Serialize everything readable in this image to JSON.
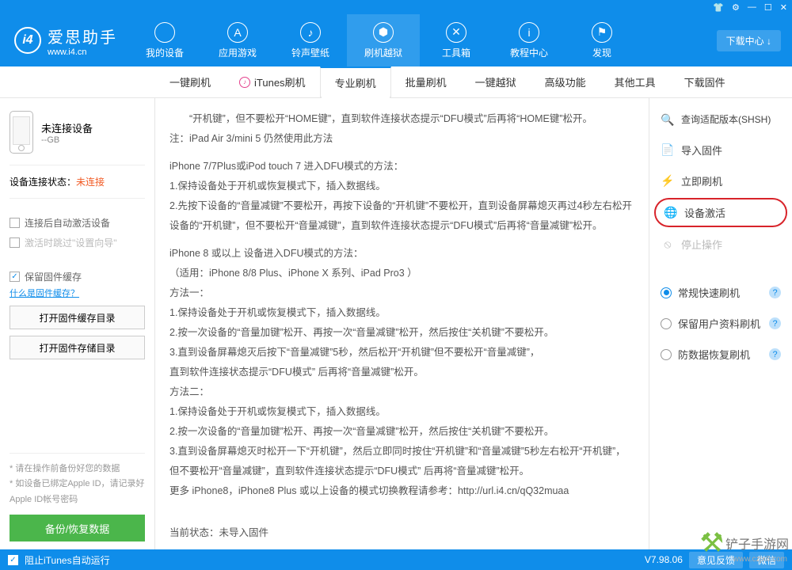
{
  "app": {
    "name": "爱思助手",
    "url": "www.i4.cn"
  },
  "window_ctrl": [
    "👕",
    "⚙",
    "—",
    "☐",
    "✕"
  ],
  "nav": [
    {
      "label": "我的设备",
      "icon": ""
    },
    {
      "label": "应用游戏",
      "icon": "A"
    },
    {
      "label": "铃声壁纸",
      "icon": "♪"
    },
    {
      "label": "刷机越狱",
      "icon": "⬢",
      "active": true
    },
    {
      "label": "工具箱",
      "icon": "✕"
    },
    {
      "label": "教程中心",
      "icon": "i"
    },
    {
      "label": "发现",
      "icon": "⚑"
    }
  ],
  "dl_center": "下载中心 ↓",
  "subnav": [
    "一键刷机",
    "iTunes刷机",
    "专业刷机",
    "批量刷机",
    "一键越狱",
    "高级功能",
    "其他工具",
    "下载固件"
  ],
  "subnav_active": 2,
  "device": {
    "name": "未连接设备",
    "size": "--GB"
  },
  "conn_status_label": "设备连接状态：",
  "conn_status_value": "未连接",
  "options": {
    "auto_activate": "连接后自动激活设备",
    "skip_wizard": "激活时跳过\"设置向导\"",
    "keep_cache": "保留固件缓存",
    "cache_help": "什么是固件缓存？"
  },
  "side_buttons": {
    "open_cache": "打开固件缓存目录",
    "open_storage": "打开固件存储目录"
  },
  "notes": [
    "* 请在操作前备份好您的数据",
    "* 如设备已绑定Apple ID，请记录好Apple ID帐号密码"
  ],
  "backup_btn": "备份/恢复数据",
  "content": {
    "l1": "“开机键”，但不要松开“HOME键”，直到软件连接状态提示“DFU模式”后再将“HOME键”松开。",
    "l2": "注：iPad Air 3/mini 5 仍然使用此方法",
    "l3": "iPhone 7/7Plus或iPod touch 7 进入DFU模式的方法：",
    "l4": "1.保持设备处于开机或恢复模式下，插入数据线。",
    "l5": "2.先按下设备的“音量减键”不要松开，再按下设备的“开机键”不要松开，直到设备屏幕熄灭再过4秒左右松开设备的“开机键”，但不要松开“音量减键”，直到软件连接状态提示“DFU模式”后再将“音量减键”松开。",
    "l6": "iPhone 8 或以上 设备进入DFU模式的方法：",
    "l7": "（适用：iPhone 8/8 Plus、iPhone X 系列、iPad Pro3 ）",
    "l8": "方法一：",
    "l9": "1.保持设备处于开机或恢复模式下，插入数据线。",
    "l10": "2.按一次设备的“音量加键”松开、再按一次“音量减键”松开，然后按住“关机键”不要松开。",
    "l11": "3.直到设备屏幕熄灭后按下“音量减键”5秒，然后松开“开机键”但不要松开“音量减键”，",
    "l12": "直到软件连接状态提示“DFU模式” 后再将“音量减键”松开。",
    "l13": "方法二：",
    "l14": "1.保持设备处于开机或恢复模式下，插入数据线。",
    "l15": "2.按一次设备的“音量加键”松开、再按一次“音量减键”松开，然后按住“关机键”不要松开。",
    "l16": "3.直到设备屏幕熄灭时松开一下“开机键”，然后立即同时按住“开机键”和“音量减键”5秒左右松开“开机键”，但不要松开“音量减键”，直到软件连接状态提示“DFU模式” 后再将“音量减键”松开。",
    "l17": "更多 iPhone8，iPhone8 Plus 或以上设备的模式切换教程请参考：http://url.i4.cn/qQ32muaa",
    "status_label": "当前状态：",
    "status_value": "未导入固件"
  },
  "right": {
    "version": "查询适配版本(SHSH)",
    "import": "导入固件",
    "flash": "立即刷机",
    "activate": "设备激活",
    "stop": "停止操作",
    "mode1": "常规快速刷机",
    "mode2": "保留用户资料刷机",
    "mode3": "防数据恢复刷机"
  },
  "footer": {
    "block_itunes": "阻止iTunes自动运行",
    "version": "V7.98.06",
    "feedback": "意见反馈",
    "wechat": "微信"
  },
  "watermark": {
    "name": "铲子手游网",
    "url": "www.czjx8.com"
  }
}
